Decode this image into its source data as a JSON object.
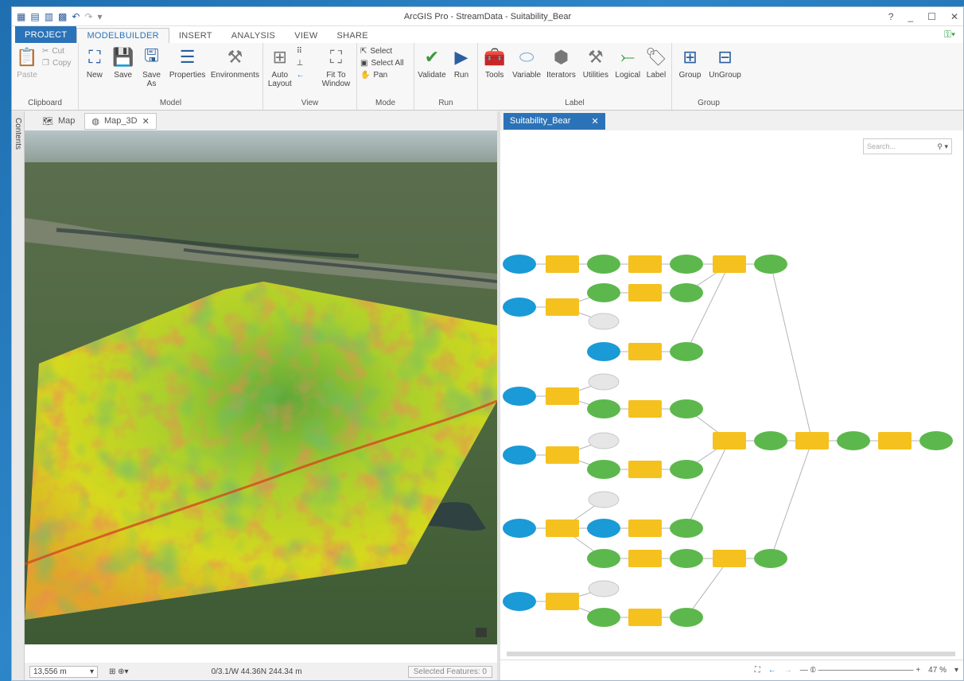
{
  "app": {
    "title": "ArcGIS Pro - StreamData - Suitability_Bear",
    "window_controls": [
      "?",
      "_",
      "☐",
      "✕"
    ]
  },
  "ribbon_tabs": [
    {
      "label": "PROJECT"
    },
    {
      "label": "MODELBUILDER"
    },
    {
      "label": "INSERT"
    },
    {
      "label": "ANALYSIS"
    },
    {
      "label": "VIEW"
    },
    {
      "label": "SHARE"
    }
  ],
  "ribbon": {
    "clipboard": {
      "label": "Clipboard",
      "paste": "Paste",
      "cut": "Cut",
      "copy": "Copy"
    },
    "model": {
      "label": "Model",
      "new": "New",
      "save": "Save",
      "save_as": "Save As",
      "properties": "Properties",
      "environments": "Environments"
    },
    "view": {
      "label": "View",
      "auto_layout": "Auto Layout",
      "fit_to_window": "Fit To Window"
    },
    "mode": {
      "label": "Mode",
      "select": "Select",
      "select_all": "Select All",
      "pan": "Pan"
    },
    "run": {
      "label": "Run",
      "validate": "Validate",
      "run": "Run"
    },
    "insert": {
      "label": "Label",
      "tools": "Tools",
      "variable": "Variable",
      "iterators": "Iterators",
      "utilities": "Utilities",
      "logical": "Logical"
    },
    "group": {
      "label": "Group",
      "group": "Group",
      "ungroup": "UnGroup"
    }
  },
  "left_pane": {
    "contents_label": "Contents",
    "tabs": [
      {
        "label": "Map"
      },
      {
        "label": "Map_3D"
      }
    ],
    "status": {
      "scale": "13,556 m",
      "coords": "0/3.1/W 44.36N  244.34 m",
      "selected": "Selected Features: 0"
    }
  },
  "right_pane": {
    "tab": "Suitability_Bear",
    "search_placeholder": "Search...",
    "zoom": "47 %"
  }
}
